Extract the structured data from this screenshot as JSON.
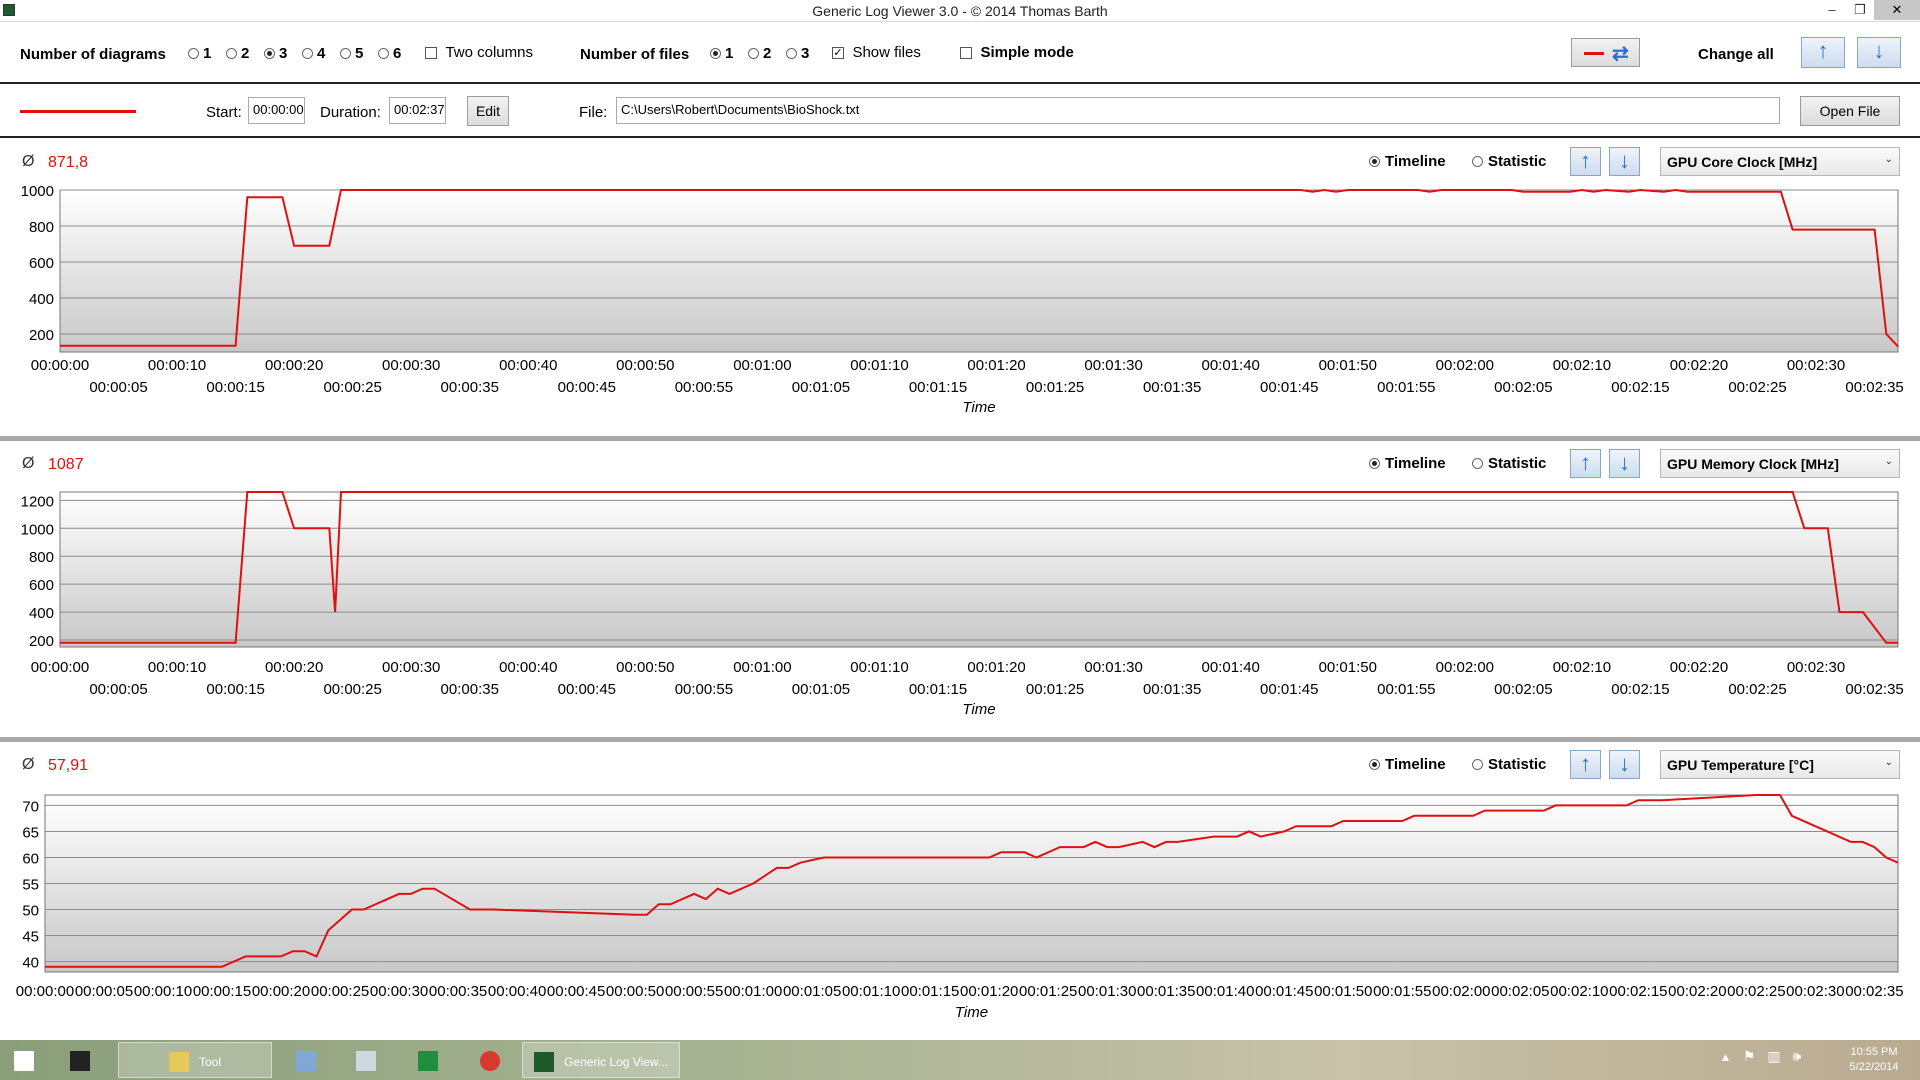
{
  "window": {
    "title": "Generic Log Viewer 3.0 - © 2014 Thomas Barth",
    "min": "–",
    "restore": "❐",
    "close": "✕"
  },
  "toolbar": {
    "num_diagrams_label": "Number of diagrams",
    "diagram_options": [
      "1",
      "2",
      "3",
      "4",
      "5",
      "6"
    ],
    "diagram_selected": "3",
    "two_columns_label": "Two columns",
    "num_files_label": "Number of files",
    "file_options": [
      "1",
      "2",
      "3"
    ],
    "file_selected": "1",
    "show_files_label": "Show files",
    "show_files_checked": true,
    "simple_mode_label": "Simple mode",
    "simple_mode_checked": false,
    "change_all_label": "Change all",
    "swap_icon": "swap-arrows",
    "up_icon": "↑",
    "down_icon": "↓"
  },
  "file_row": {
    "line_color": "#e01010",
    "start_label": "Start:",
    "start_value": "00:00:00",
    "duration_label": "Duration:",
    "duration_value": "00:02:37",
    "edit_label": "Edit",
    "file_label": "File:",
    "file_path": "C:\\Users\\Robert\\Documents\\BioShock.txt",
    "open_file_label": "Open File"
  },
  "diagram_common": {
    "avg_symbol": "Ø",
    "timeline_label": "Timeline",
    "statistic_label": "Statistic",
    "xlabel": "Time",
    "x_ticks": [
      "00:00:00",
      "00:00:05",
      "00:00:10",
      "00:00:15",
      "00:00:20",
      "00:00:25",
      "00:00:30",
      "00:00:35",
      "00:00:40",
      "00:00:45",
      "00:00:50",
      "00:00:55",
      "00:01:00",
      "00:01:05",
      "00:01:10",
      "00:01:15",
      "00:01:20",
      "00:01:25",
      "00:01:30",
      "00:01:35",
      "00:01:40",
      "00:01:45",
      "00:01:50",
      "00:01:55",
      "00:02:00",
      "00:02:05",
      "00:02:10",
      "00:02:15",
      "00:02:20",
      "00:02:25",
      "00:02:30",
      "00:02:35"
    ]
  },
  "chart_data": [
    {
      "type": "line",
      "title": "GPU Core Clock [MHz]",
      "average": "871,8",
      "xlabel": "Time",
      "xlim": [
        0,
        157
      ],
      "ylim": [
        100,
        1000
      ],
      "y_ticks": [
        200,
        400,
        600,
        800,
        1000
      ],
      "color": "#e01010",
      "series": [
        {
          "x": [
            0,
            15,
            16,
            19,
            20,
            23,
            24,
            106,
            107,
            108,
            109,
            110,
            116,
            117,
            118,
            124,
            125,
            129,
            130,
            131,
            132,
            134,
            135,
            137,
            138,
            139,
            140,
            147,
            148,
            150,
            155,
            156,
            157
          ],
          "y": [
            135,
            135,
            960,
            960,
            690,
            690,
            1000,
            1000,
            990,
            1000,
            990,
            1000,
            1000,
            990,
            1000,
            1000,
            990,
            990,
            1000,
            990,
            1000,
            990,
            1000,
            990,
            1000,
            990,
            990,
            990,
            780,
            780,
            780,
            200,
            130
          ]
        }
      ]
    },
    {
      "type": "line",
      "title": "GPU Memory Clock [MHz]",
      "average": "1087",
      "xlabel": "Time",
      "xlim": [
        0,
        157
      ],
      "ylim": [
        150,
        1260
      ],
      "y_ticks": [
        200,
        400,
        600,
        800,
        1000,
        1200
      ],
      "color": "#e01010",
      "series": [
        {
          "x": [
            0,
            15,
            16,
            19,
            20,
            23,
            23.5,
            24,
            148,
            149,
            151,
            152,
            154,
            156,
            157
          ],
          "y": [
            180,
            180,
            1260,
            1260,
            1000,
            1000,
            400,
            1260,
            1260,
            1000,
            1000,
            400,
            400,
            180,
            180
          ]
        }
      ]
    },
    {
      "type": "line",
      "title": "GPU Temperature [°C]",
      "average": "57,91",
      "xlabel": "Time",
      "xlim": [
        0,
        157
      ],
      "ylim": [
        38,
        72
      ],
      "y_ticks": [
        40,
        45,
        50,
        55,
        60,
        65,
        70
      ],
      "color": "#e01010",
      "series": [
        {
          "x": [
            0,
            15,
            17,
            20,
            21,
            22,
            23,
            24,
            26,
            27,
            30,
            31,
            32,
            33,
            36,
            38,
            50,
            51,
            52,
            53,
            55,
            56,
            57,
            58,
            60,
            62,
            63,
            64,
            66,
            80,
            81,
            83,
            84,
            86,
            88,
            89,
            90,
            91,
            93,
            94,
            95,
            96,
            99,
            100,
            101,
            102,
            103,
            105,
            106,
            109,
            110,
            115,
            116,
            121,
            122,
            127,
            128,
            134,
            135,
            136,
            137,
            145,
            146,
            147,
            148,
            151,
            153,
            154,
            155,
            156,
            157
          ],
          "y": [
            39,
            39,
            41,
            41,
            42,
            42,
            41,
            46,
            50,
            50,
            53,
            53,
            54,
            54,
            50,
            50,
            49,
            49,
            51,
            51,
            53,
            52,
            54,
            53,
            55,
            58,
            58,
            59,
            60,
            60,
            61,
            61,
            60,
            62,
            62,
            63,
            62,
            62,
            63,
            62,
            63,
            63,
            64,
            64,
            64,
            65,
            64,
            65,
            66,
            66,
            67,
            67,
            68,
            68,
            69,
            69,
            70,
            70,
            71,
            71,
            71,
            72,
            72,
            72,
            68,
            65,
            63,
            63,
            62,
            60,
            59
          ]
        }
      ]
    }
  ],
  "taskbar": {
    "items": [
      {
        "label": "",
        "icon": "windows-logo"
      },
      {
        "label": "",
        "icon": "gamepad"
      },
      {
        "label": "Tool",
        "icon": "folder"
      },
      {
        "label": "",
        "icon": "paint"
      },
      {
        "label": "",
        "icon": "calculator"
      },
      {
        "label": "",
        "icon": "store"
      },
      {
        "label": "",
        "icon": "chrome"
      },
      {
        "label": "Generic Log View...",
        "icon": "log-viewer"
      }
    ],
    "time": "10:55 PM",
    "date": "5/22/2014"
  }
}
